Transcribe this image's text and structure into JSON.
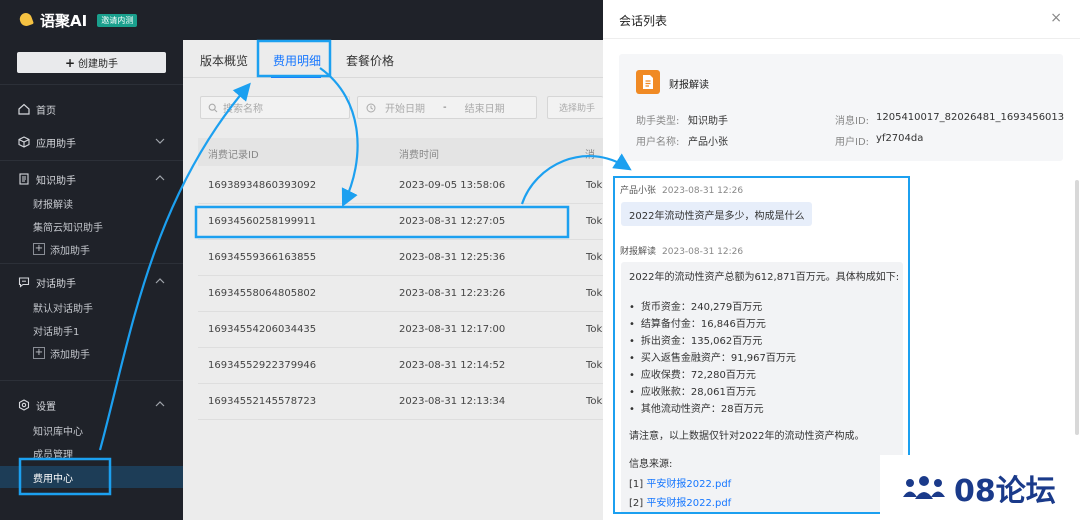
{
  "app": {
    "name": "语聚AI",
    "badge": "邀请内测",
    "create_button": "创建助手"
  },
  "sidebar": {
    "home": "首页",
    "apps": "应用助手",
    "knowledge": {
      "label": "知识助手",
      "items": [
        "财报解读",
        "集简云知识助手"
      ],
      "add": "添加助手"
    },
    "dialog": {
      "label": "对话助手",
      "items": [
        "默认对话助手",
        "对话助手1"
      ],
      "add": "添加助手"
    },
    "settings": {
      "label": "设置",
      "items": [
        "知识库中心",
        "成员管理",
        "费用中心"
      ]
    }
  },
  "main": {
    "tabs": [
      "版本概览",
      "费用明细",
      "套餐价格"
    ],
    "active_tab": 1,
    "search_placeholder": "搜索名称",
    "date_start_placeholder": "开始日期",
    "date_sep": "-",
    "date_end_placeholder": "结束日期",
    "select_placeholder": "选择助手",
    "columns": [
      "消费记录ID",
      "消费时间",
      "消"
    ],
    "rows": [
      {
        "id": "16938934860393092",
        "time": "2023-09-05 13:58:06",
        "extra": "Tok"
      },
      {
        "id": "16934560258199911",
        "time": "2023-08-31 12:27:05",
        "extra": "Tok"
      },
      {
        "id": "16934559366163855",
        "time": "2023-08-31 12:25:36",
        "extra": "Tok"
      },
      {
        "id": "16934558064805802",
        "time": "2023-08-31 12:23:26",
        "extra": "Tok"
      },
      {
        "id": "16934554206034435",
        "time": "2023-08-31 12:17:00",
        "extra": "Tok"
      },
      {
        "id": "16934552922379946",
        "time": "2023-08-31 12:14:52",
        "extra": "Tok"
      },
      {
        "id": "16934552145578723",
        "time": "2023-08-31 12:13:34",
        "extra": "Tok"
      }
    ]
  },
  "panel": {
    "title": "会话列表",
    "close": "×",
    "assistant_name": "财报解读",
    "type_label": "助手类型:",
    "type_value": "知识助手",
    "msgid_label": "消息ID:",
    "msgid_value": "1205410017_82026481_1693456013",
    "username_label": "用户名称:",
    "username_value": "产品小张",
    "userid_label": "用户ID:",
    "userid_value": "yf2704da",
    "question": {
      "user": "产品小张",
      "time": "2023-08-31 12:26",
      "text": "2022年流动性资产是多少，构成是什么"
    },
    "answer": {
      "user": "财报解读",
      "time": "2023-08-31 12:26",
      "intro": "2022年的流动性资产总额为612,871百万元。具体构成如下:",
      "bullets": [
        "货币资金：240,279百万元",
        "结算备付金：16,846百万元",
        "拆出资金：135,062百万元",
        "买入返售金融资产：91,967百万元",
        "应收保费：72,280百万元",
        "应收账款：28,061百万元",
        "其他流动性资产：28百万元"
      ],
      "note": "请注意，以上数据仅针对2022年的流动性资产构成。",
      "source_label": "信息来源:",
      "sources": [
        {
          "index": "[1]",
          "name": "平安财报2022.pdf"
        },
        {
          "index": "[2]",
          "name": "平安财报2022.pdf"
        }
      ]
    }
  },
  "watermark": "08论坛",
  "colors": {
    "sidebar_bg": "#1f2229",
    "accent": "#1677ff",
    "highlight": "#1ca0f0",
    "doc_icon": "#f08a24"
  }
}
